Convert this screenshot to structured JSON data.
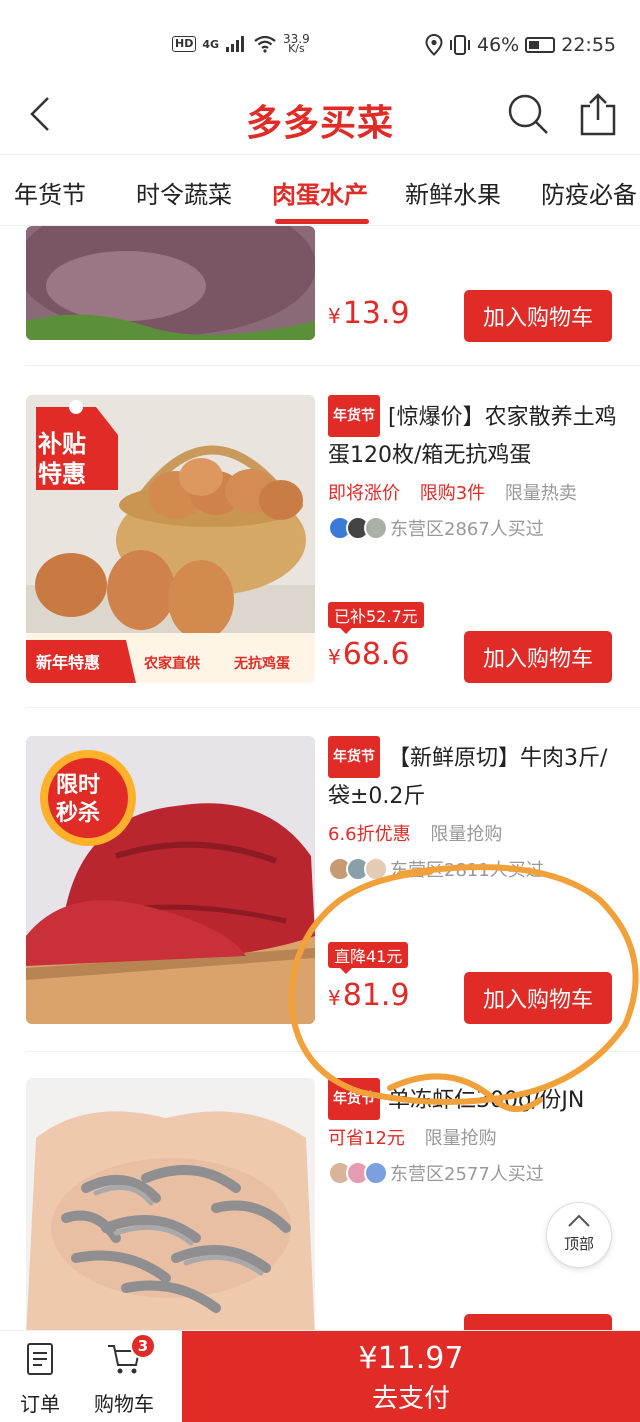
{
  "status_bar": {
    "hd": "HD",
    "network": "4G",
    "speed_value": "33.9",
    "speed_unit": "K/s",
    "battery": "46%",
    "battery_level": 0.46,
    "time": "22:55"
  },
  "header": {
    "title": "多多买菜"
  },
  "tabs": [
    {
      "label": "年货节",
      "active": false
    },
    {
      "label": "时令蔬菜",
      "active": false
    },
    {
      "label": "肉蛋水产",
      "active": true
    },
    {
      "label": "新鲜水果",
      "active": false
    },
    {
      "label": "防疫必备",
      "active": false
    }
  ],
  "products": [
    {
      "price_symbol": "¥",
      "price": "13.9",
      "cart_label": "加入购物车"
    },
    {
      "tag": "年货节",
      "title": "[惊爆价】农家散养土鸡蛋120枚/箱无抗鸡蛋",
      "promos": [
        {
          "text": "即将涨价",
          "color": "red"
        },
        {
          "text": "限购3件",
          "color": "red"
        },
        {
          "text": "限量热卖",
          "color": "gray"
        }
      ],
      "buyers": "东营区2867人买过",
      "subsidy": "已补52.7元",
      "price_symbol": "¥",
      "price": "68.6",
      "cart_label": "加入购物车",
      "image_badge_top": "补贴",
      "image_badge_bottom": "特惠",
      "image_banner_left": "新年特惠",
      "image_banner_mid": "农家直供",
      "image_banner_right": "无抗鸡蛋"
    },
    {
      "tag": "年货节",
      "title": "【新鲜原切】牛肉3斤/袋±0.2斤",
      "promos": [
        {
          "text": "6.6折优惠",
          "color": "red"
        },
        {
          "text": "限量抢购",
          "color": "gray"
        }
      ],
      "buyers": "东营区2811人买过",
      "subsidy": "直降41元",
      "price_symbol": "¥",
      "price": "81.9",
      "cart_label": "加入购物车",
      "image_badge_top": "限时",
      "image_badge_bottom": "秒杀"
    },
    {
      "tag": "年货节",
      "title": "单冻虾仁300g/份JN",
      "promos": [
        {
          "text": "可省12元",
          "color": "red"
        },
        {
          "text": "限量抢购",
          "color": "gray"
        }
      ],
      "buyers": "东营区2577人买过"
    }
  ],
  "top_button": "顶部",
  "bottom_bar": {
    "orders_label": "订单",
    "cart_label": "购物车",
    "cart_count": "3",
    "pay_amount": "¥11.97",
    "pay_label": "去支付"
  },
  "colors": {
    "accent": "#e02b27",
    "annotation": "#f2a13a"
  }
}
